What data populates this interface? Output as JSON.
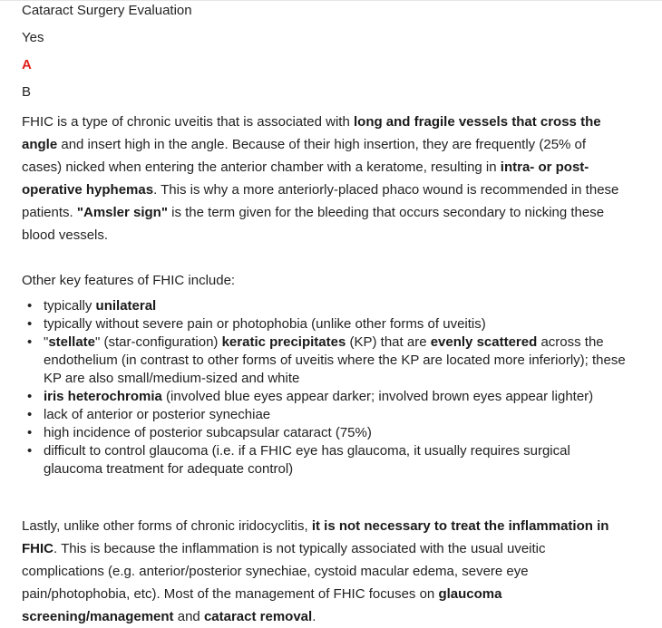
{
  "title": "Cataract Surgery Evaluation",
  "answer": "Yes",
  "option_a": "A",
  "option_b": "B",
  "paragraph1": {
    "t1": "FHIC is a type of chronic uveitis that is associated with ",
    "b1": "long and fragile vessels that cross the angle",
    "t2": " and insert high in the angle.  Because of their high insertion, they are frequently (25% of cases) nicked when entering the anterior chamber with a keratome, resulting in ",
    "b2": "intra- or post-operative hyphemas",
    "t3": ".  This is why a more anteriorly-placed phaco wound is recommended in these patients.  ",
    "b3": "\"Amsler sign\"",
    "t4": " is the term given for the bleeding that occurs secondary to nicking these blood vessels."
  },
  "features_intro": "Other key features of FHIC include:",
  "features": {
    "f1": {
      "t1": "typically ",
      "b1": "unilateral"
    },
    "f2": {
      "t1": "typically without severe pain or photophobia (unlike other forms of uveitis)"
    },
    "f3": {
      "t1": "\"",
      "b1": "stellate",
      "t2": "\" (star-configuration) ",
      "b2": "keratic precipitates",
      "t3": " (KP) that are ",
      "b3": "evenly scattered",
      "t4": " across the endothelium (in contrast to other forms of uveitis where the KP are located more inferiorly); these KP are also small/medium-sized and white"
    },
    "f4": {
      "b1": "iris heterochromia",
      "t1": " (involved blue eyes appear darker; involved brown eyes appear lighter)"
    },
    "f5": {
      "t1": "lack of anterior or posterior synechiae"
    },
    "f6": {
      "t1": "high incidence of posterior subcapsular cataract (75%)"
    },
    "f7": {
      "t1": "difficult to control glaucoma (i.e. if a FHIC eye has glaucoma, it usually requires surgical glaucoma treatment for adequate control)"
    }
  },
  "paragraph3": {
    "t1": "Lastly, unlike other forms of chronic iridocyclitis, ",
    "b1": "it is not necessary to treat the inflammation in FHIC",
    "t2": ".  This is because the inflammation is not typically associated with the usual uveitic complications (e.g. anterior/posterior synechiae, cystoid macular edema, severe eye pain/photophobia, etc).  Most of the management of FHIC focuses on ",
    "b2": "glaucoma screening/management",
    "t3": " and ",
    "b3": "cataract removal",
    "t4": "."
  }
}
